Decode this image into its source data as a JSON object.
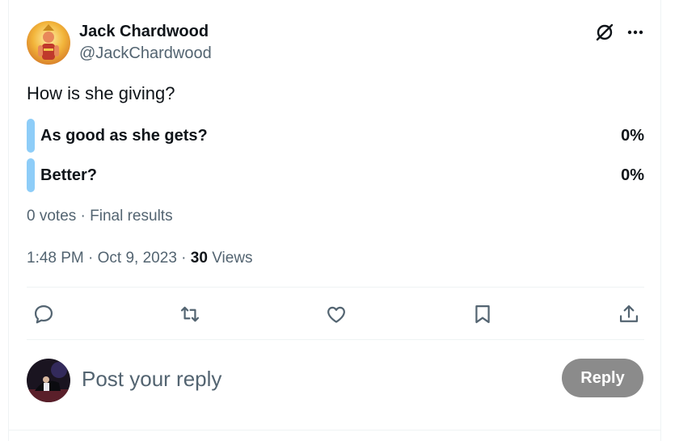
{
  "author": {
    "name": "Jack Chardwood",
    "handle": "@JackChardwood"
  },
  "tweet": {
    "text": "How is she giving?"
  },
  "poll": {
    "options": [
      {
        "label": "As good as she gets?",
        "percent": "0%"
      },
      {
        "label": "Better?",
        "percent": "0%"
      }
    ],
    "meta": "0 votes · Final results"
  },
  "meta": {
    "time": "1:48 PM",
    "separator": " · ",
    "date": "Oct 9, 2023",
    "views_count": "30",
    "views_label": " Views"
  },
  "actions": {
    "icons": [
      "reply-icon",
      "retweet-icon",
      "like-icon",
      "bookmark-icon",
      "share-icon"
    ]
  },
  "reply": {
    "placeholder": "Post your reply",
    "button_label": "Reply"
  },
  "colors": {
    "poll_bar": "#8ecdf8",
    "secondary_text": "#536471",
    "reply_button": "#8b8b8b",
    "divider": "#eff3f4"
  }
}
